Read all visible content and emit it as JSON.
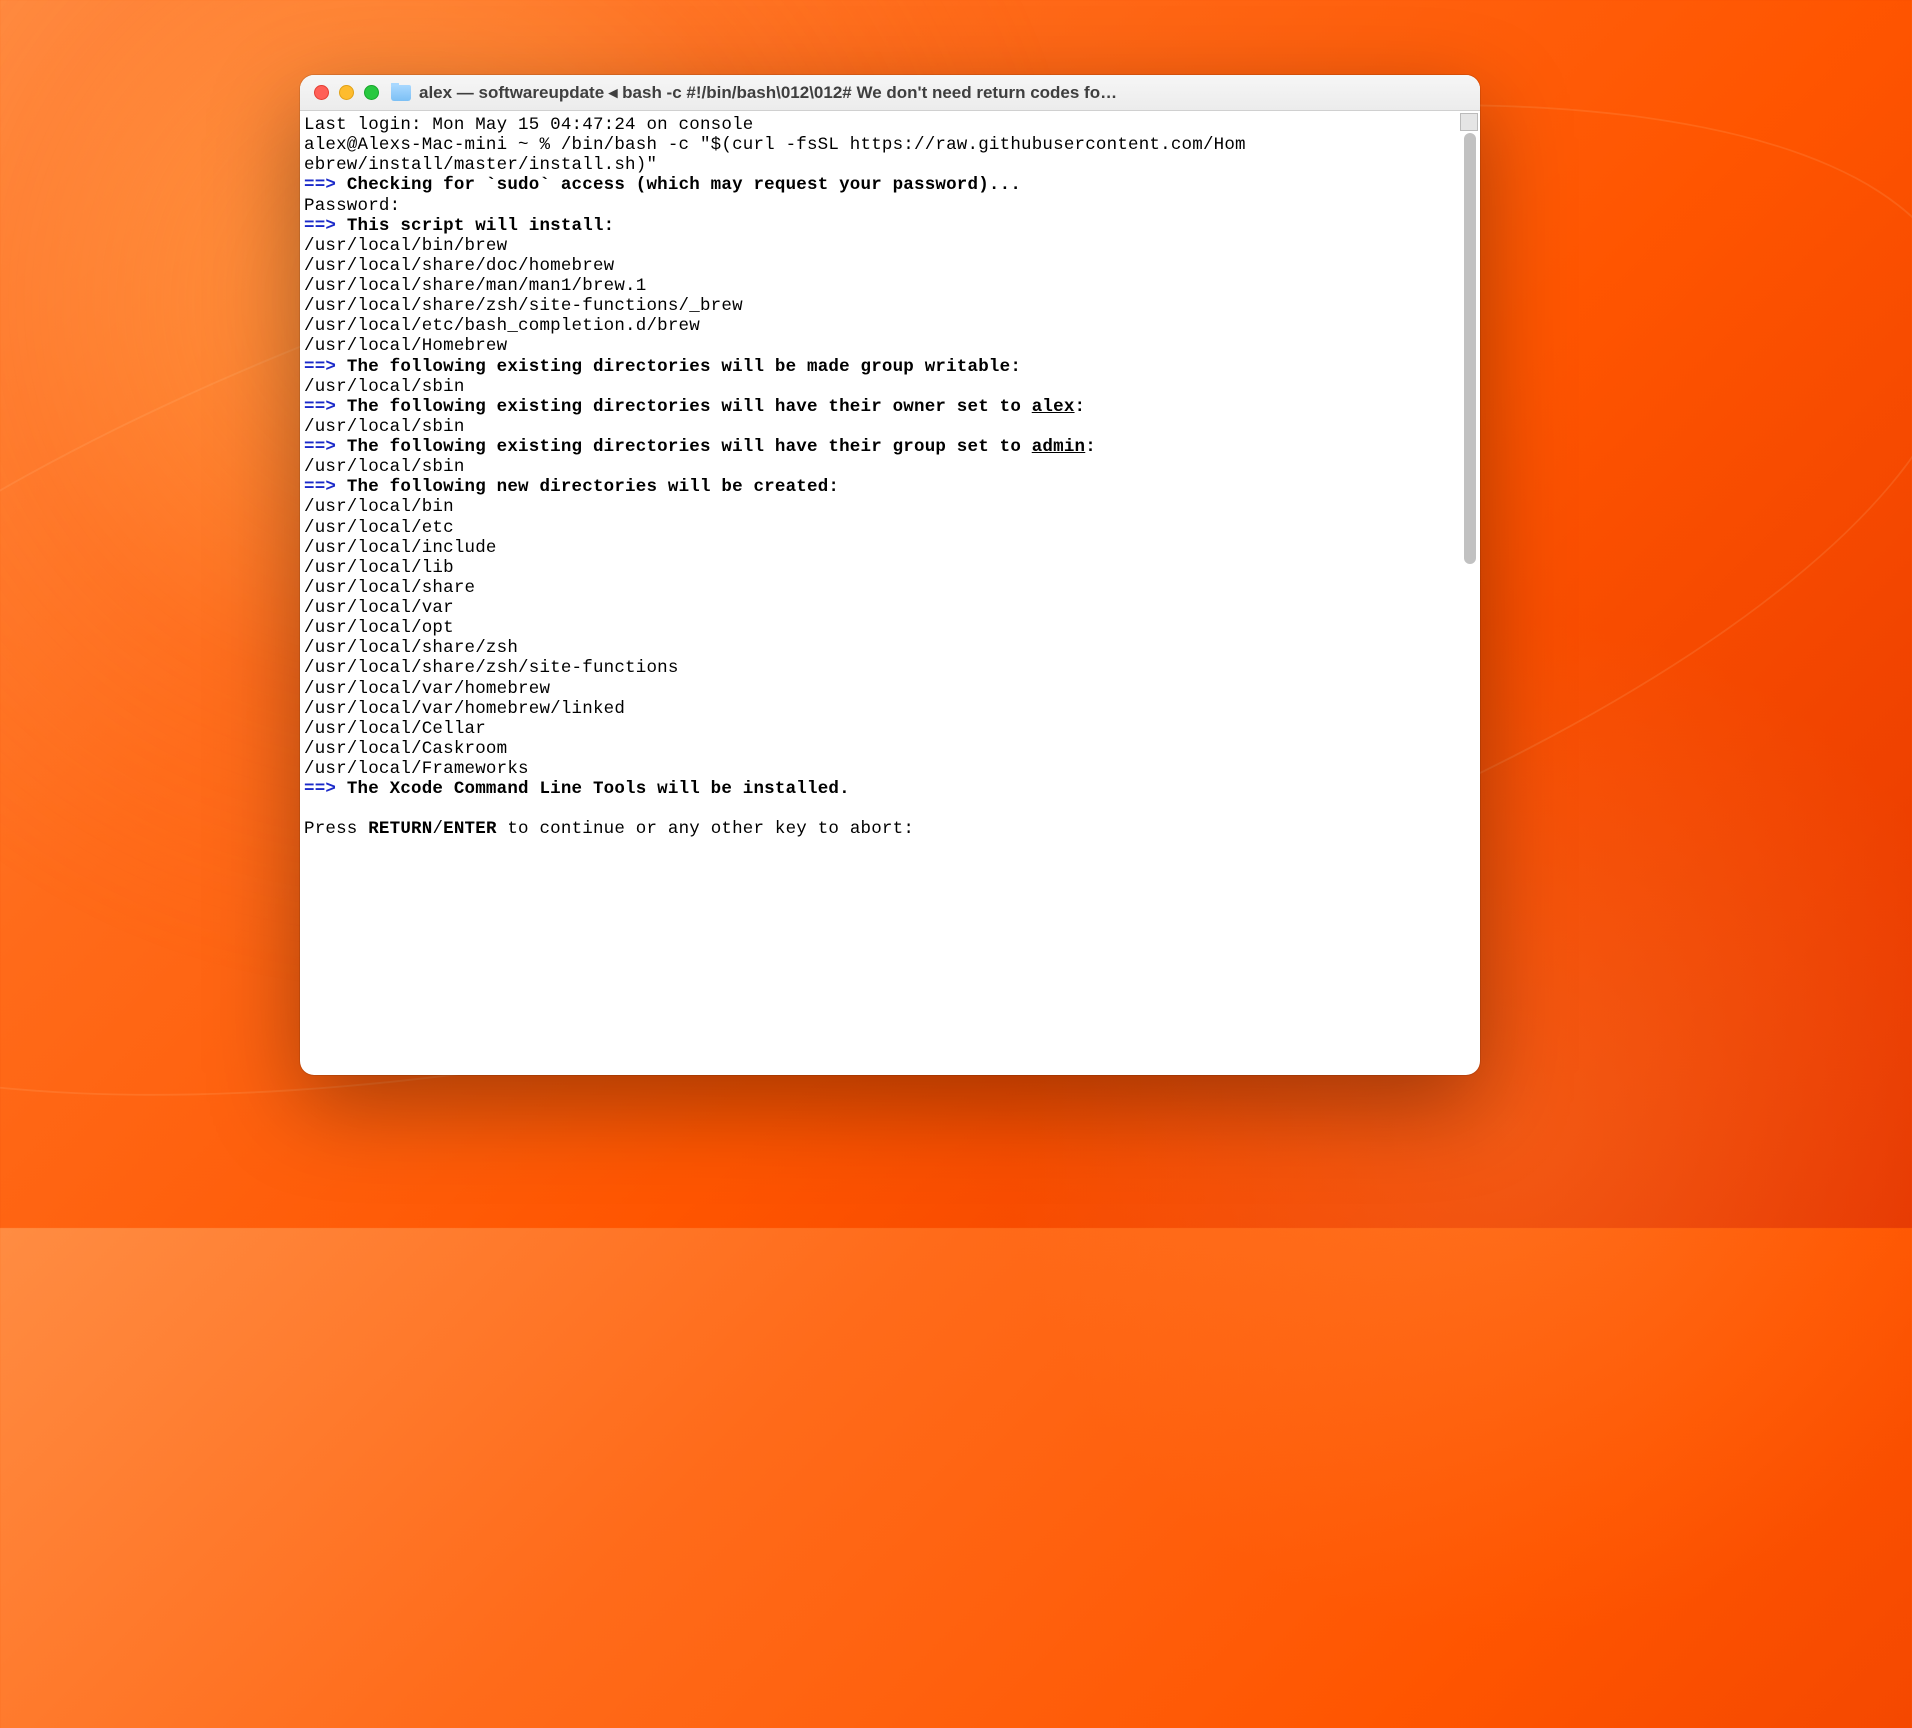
{
  "window": {
    "title": "alex — softwareupdate ◂ bash -c #!/bin/bash\\012\\012# We don't need return codes fo…"
  },
  "term": {
    "last_login": "Last login: Mon May 15 04:47:24 on console",
    "prompt_line1": "alex@Alexs-Mac-mini ~ % /bin/bash -c \"$(curl -fsSL https://raw.githubusercontent.com/Hom",
    "prompt_line2": "ebrew/install/master/install.sh)\"",
    "arrow": "==>",
    "checking_sudo": "Checking for `sudo` access (which may request your password)...",
    "password": "Password:",
    "will_install": "This script will install:",
    "install_paths": [
      "/usr/local/bin/brew",
      "/usr/local/share/doc/homebrew",
      "/usr/local/share/man/man1/brew.1",
      "/usr/local/share/zsh/site-functions/_brew",
      "/usr/local/etc/bash_completion.d/brew",
      "/usr/local/Homebrew"
    ],
    "group_writable": "The following existing directories will be made group writable:",
    "sbin": "/usr/local/sbin",
    "owner_set_pre": "The following existing directories will have their owner set to ",
    "owner_user": "alex",
    "group_set_pre": "The following existing directories will have their group set to ",
    "group_name": "admin",
    "new_dirs": "The following new directories will be created:",
    "new_dir_paths": [
      "/usr/local/bin",
      "/usr/local/etc",
      "/usr/local/include",
      "/usr/local/lib",
      "/usr/local/share",
      "/usr/local/var",
      "/usr/local/opt",
      "/usr/local/share/zsh",
      "/usr/local/share/zsh/site-functions",
      "/usr/local/var/homebrew",
      "/usr/local/var/homebrew/linked",
      "/usr/local/Cellar",
      "/usr/local/Caskroom",
      "/usr/local/Frameworks"
    ],
    "xcode": "The Xcode Command Line Tools will be installed.",
    "press_return_pre": "Press ",
    "return_enter": "RETURN",
    "slash": "/",
    "enter": "ENTER",
    "press_return_post": " to continue or any other key to abort:"
  }
}
